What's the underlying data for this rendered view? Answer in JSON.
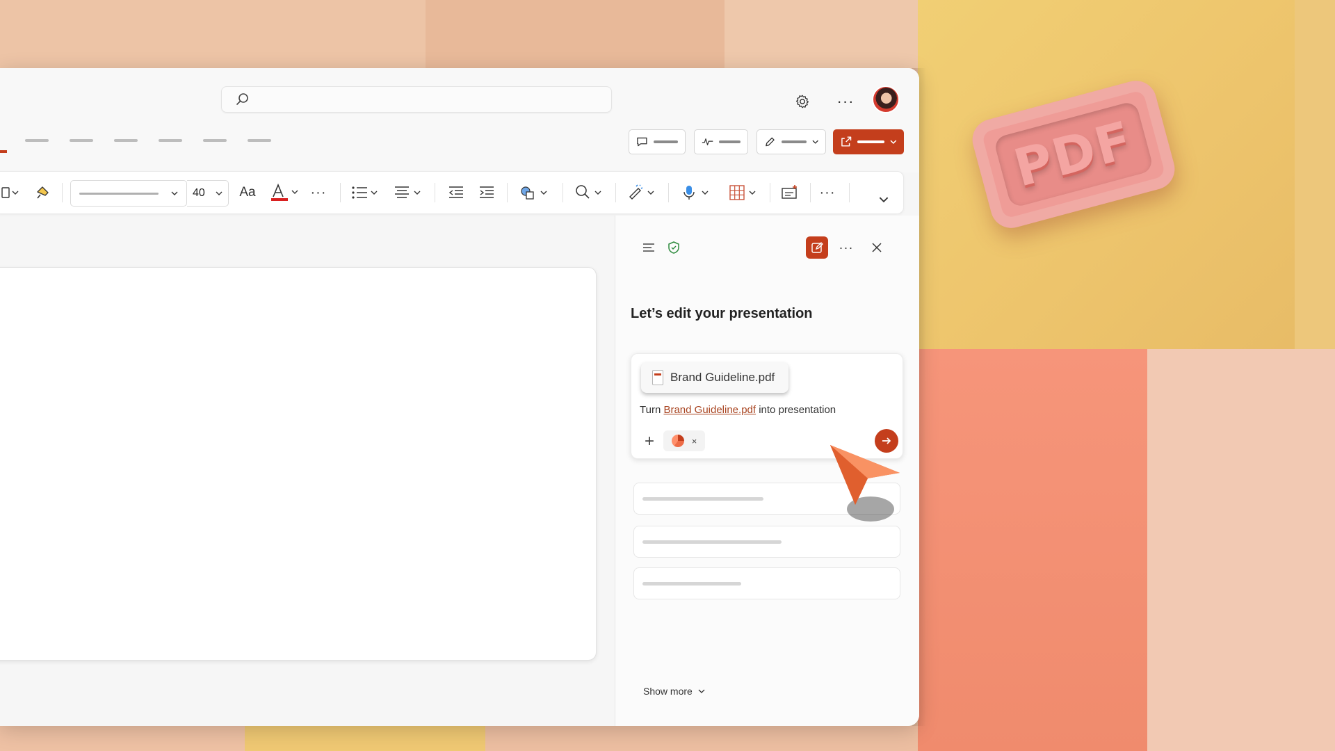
{
  "search": {
    "icon": "search-icon"
  },
  "topbar": {
    "settings_icon": "gear-icon",
    "more_icon": "more-horizontal-icon",
    "more_label": "···",
    "avatar": "user-avatar"
  },
  "ribbon": {
    "font_size": "40",
    "change_case_label": "Aa",
    "more_label": "···"
  },
  "copilot": {
    "title": "Let’s edit your presentation",
    "attachment": "Brand Guideline.pdf",
    "prompt_before": "Turn ",
    "prompt_link": "Brand Guideline.pdf",
    "prompt_after": " into presentation",
    "add_label": "+",
    "remove_label": "×",
    "show_more": "Show more"
  },
  "background": {
    "stamp_text": "PDF"
  },
  "colors": {
    "accent": "#c43e1c",
    "link": "#a8431f"
  }
}
